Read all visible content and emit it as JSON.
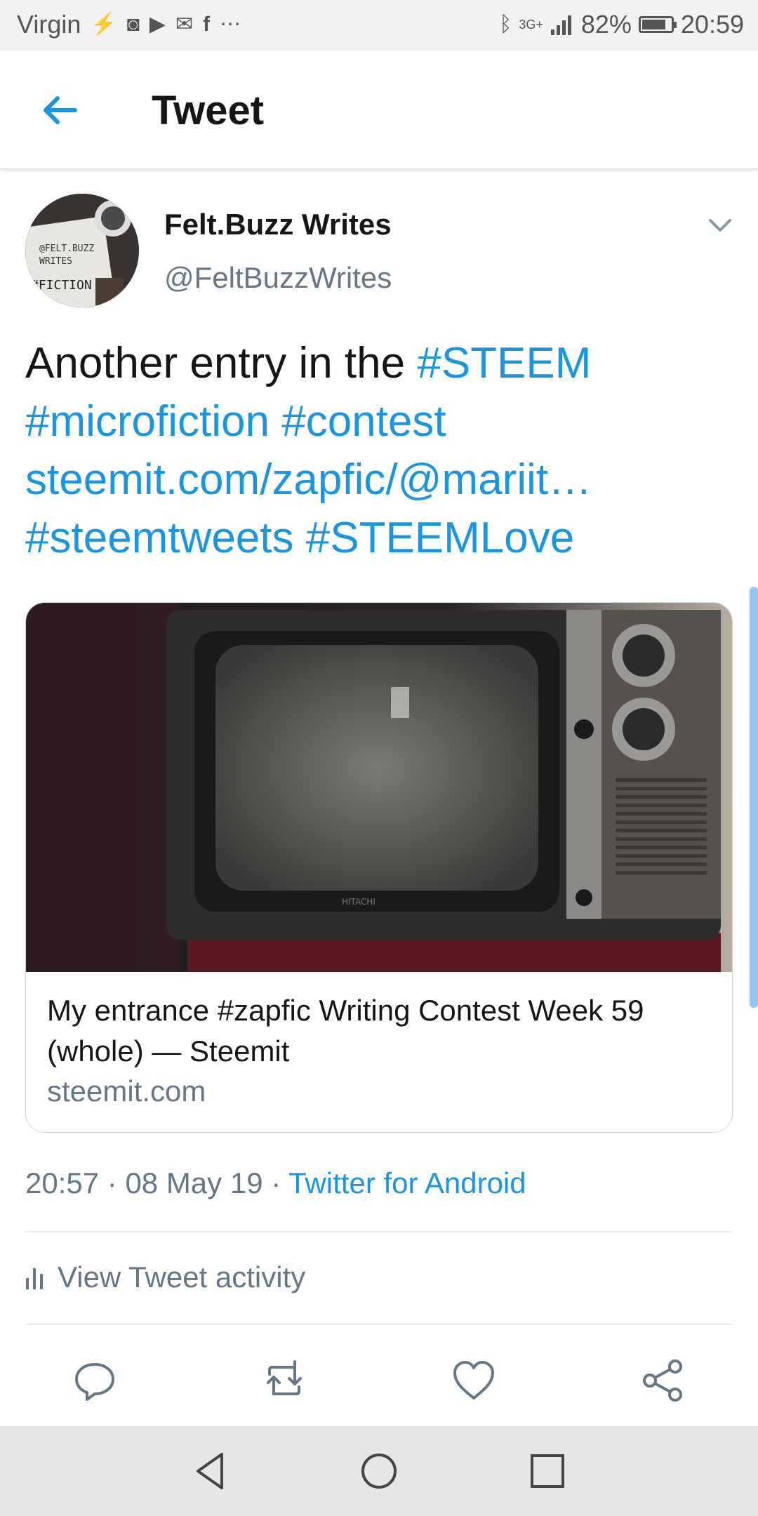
{
  "status_bar": {
    "carrier": "Virgin",
    "network": "3G+",
    "battery": "82%",
    "battery_level": 0.82,
    "time": "20:59",
    "icons": [
      "activity-icon",
      "gamepad-icon",
      "play-store-icon",
      "gmail-icon",
      "facebook-icon",
      "more-icon",
      "bluetooth-icon",
      "signal-icon",
      "battery-icon"
    ]
  },
  "header": {
    "title": "Tweet",
    "back_icon": "back-arrow-icon"
  },
  "tweet": {
    "display_name": "Felt.Buzz Writes",
    "handle": "@FeltBuzzWrites",
    "avatar_text": [
      "@FELT.BUZZ",
      "WRITES",
      "#FICTION"
    ],
    "text_plain": "Another entry in the ",
    "hashtag_steem": "#STEEM",
    "hashtag_microfiction": "#microfiction",
    "hashtag_contest": "#contest",
    "link": "steemit.com/zapfic/@mariit…",
    "hashtag_steemtweets": "#steemtweets",
    "hashtag_steemlove": "#STEEMLove",
    "card": {
      "title": "My entrance #zapfic Writing Contest Week 59 (whole) — Steemit",
      "domain": "steemit.com",
      "image": "vintage-tv-photo",
      "tv_brand": "HITACHI"
    },
    "time": "20:57",
    "date": "08 May 19",
    "separator": " · ",
    "source": "Twitter for Android",
    "activity_label": "View Tweet activity"
  },
  "actions": [
    "reply-icon",
    "retweet-icon",
    "like-icon",
    "share-icon"
  ],
  "navbar": [
    "back-nav-icon",
    "home-nav-icon",
    "recents-nav-icon"
  ],
  "colors": {
    "accent": "#1b95e0",
    "secondary_text": "#657786",
    "primary_text": "#14171a"
  }
}
